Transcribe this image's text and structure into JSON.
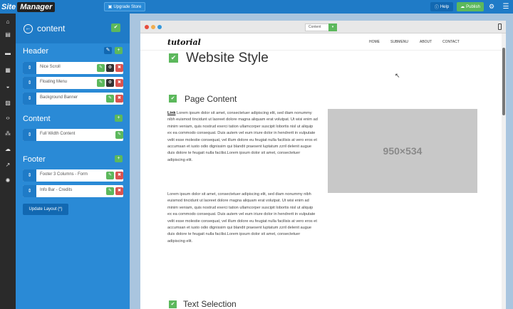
{
  "app": {
    "logo_site": "Site",
    "logo_manager": "Manager"
  },
  "topbar": {
    "upgrade_label": "Upgrade Store",
    "help_label": "Help",
    "publish_label": "Publish"
  },
  "rail": {
    "icons": [
      "home-icon",
      "pages-icon",
      "folder-icon",
      "grid-icon",
      "theme-icon",
      "image-icon",
      "code-icon",
      "share-icon",
      "cloud-icon",
      "external-icon",
      "settings-icon"
    ]
  },
  "panel": {
    "title": "content",
    "sections": {
      "header": {
        "label": "Header",
        "items": [
          "Nice Scroll",
          "Floating Menu",
          "Background Banner"
        ]
      },
      "content": {
        "label": "Content",
        "items": [
          "Full Width Content"
        ]
      },
      "footer": {
        "label": "Footer",
        "items": [
          "Footer 3 Columns - Form",
          "Info Bar - Credits"
        ]
      }
    },
    "update_label": "Update Layout (*)"
  },
  "browser": {
    "address": "Content",
    "colors": {
      "close": "#e74c3c",
      "minimize": "#f0ad4e",
      "maximize": "#3498db"
    }
  },
  "site": {
    "brand": "tutorial",
    "nav": [
      "HOME",
      "SUBMENU",
      "ABOUT",
      "CONTACT"
    ],
    "heading": "Website Style",
    "subheading": "Page Content",
    "paragraph1_link": "Link",
    "paragraph1": " Lorem ipsum dolor sit amet, consectetuer adipiscing elit, sed diam nonummy nibh euismod tincidunt ut laoreet dolore magna aliquam erat volutpat. Ut wisi enim ad minim veniam, quis nostrud exerci tation ullamcorper suscipit lobortis nisl ut aliquip ex ea commodo consequat. Duis autem vel eum iriure dolor in hendrerit in vulputate velit esse molestie consequat, vel illum dolore eu feugiat nulla facilisis at vero eros et accumsan et iusto odio dignissim qui blandit praesent luptatum zzril delenit augue duis dolore te feugait nulla facilisi.Lorem ipsum dolor sit amet, consectetuer adipiscing elit.",
    "paragraph2": "Lorem ipsum dolor sit amet, consectetuer adipiscing elit, sed diam nonummy nibh euismod tincidunt ut laoreet dolore magna aliquam erat volutpat. Ut wisi enim ad minim veniam, quis nostrud exerci tation ullamcorper suscipit lobortis nisl ut aliquip ex ea commodo consequat. Duis autem vel eum iriure dolor in hendrerit in vulputate velit esse molestie consequat, vel illum dolore eu feugiat nulla facilisis at vero eros et accumsan et iusto odio dignissim qui blandit praesent luptatum zzril delenit augue duis dolore te feugait nulla facilisi.Lorem ipsum dolor sit amet, consectetuer adipiscing elit.",
    "image_placeholder": "950×534",
    "next_heading": "Text Selection"
  }
}
